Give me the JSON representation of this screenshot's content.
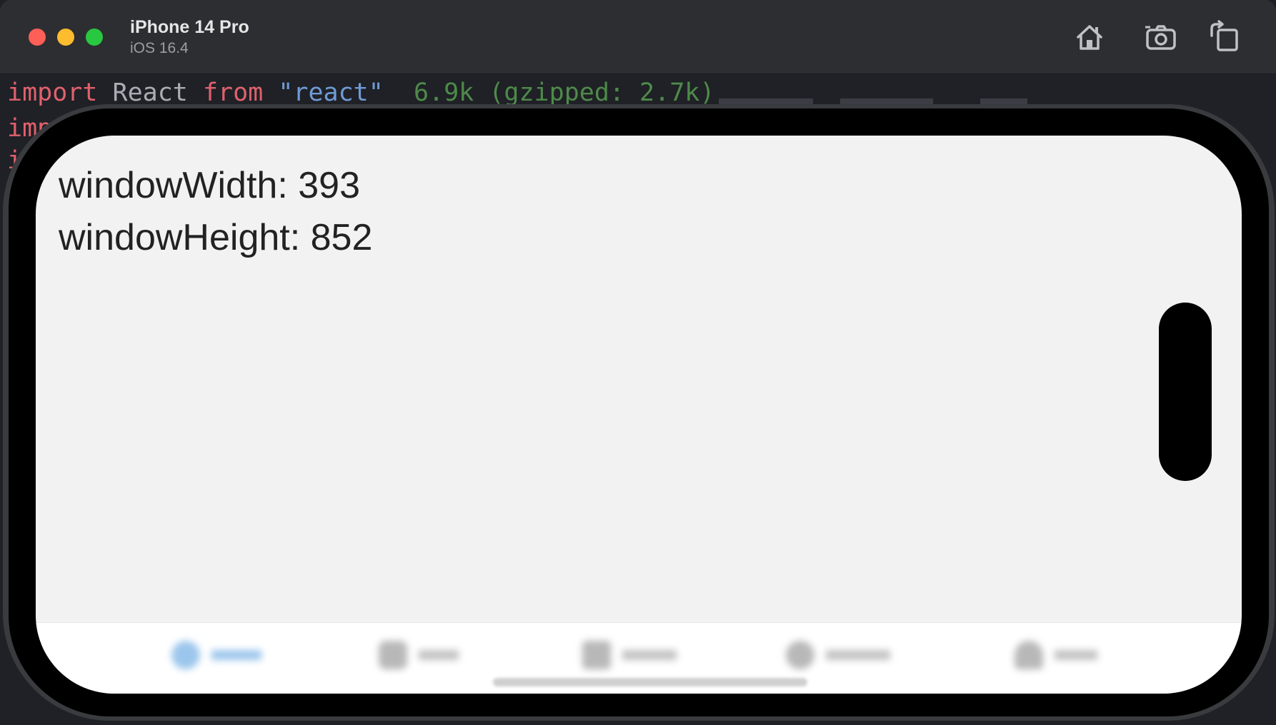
{
  "window": {
    "device_name": "iPhone 14 Pro",
    "os_version": "iOS 16.4",
    "toolbar_icons": [
      "home-icon",
      "screenshot-icon",
      "rotate-icon"
    ]
  },
  "editor_background": {
    "line1": {
      "kw1": "import",
      "ident": " React ",
      "kw2": "from",
      "str": " \"react\"",
      "size": "  6.9k (gzipped: 2.7k)"
    },
    "line2_fragment": "imp",
    "line3_fragment": "i"
  },
  "app": {
    "window_width_text": "windowWidth: 393",
    "window_height_text": "windowHeight: 852"
  },
  "colors": {
    "accent": "#5aa0e0",
    "close": "#fe5f57",
    "minimize": "#febc2e",
    "maximize": "#28c840"
  }
}
